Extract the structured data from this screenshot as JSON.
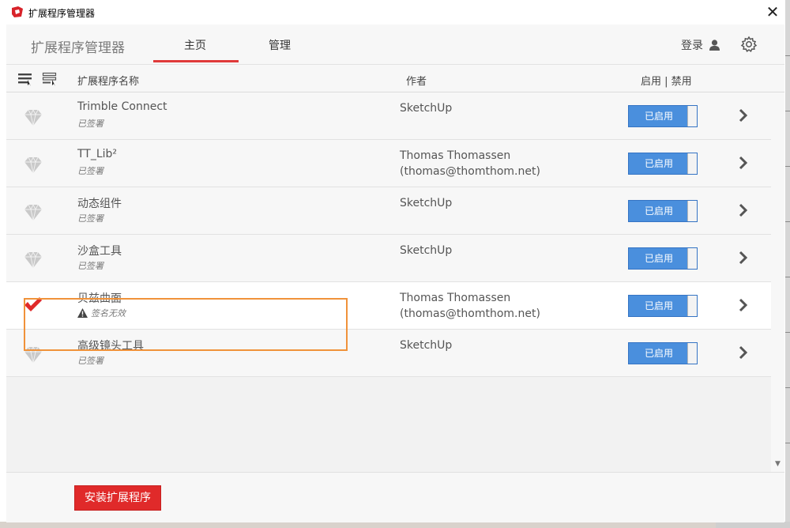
{
  "window": {
    "title": "扩展程序管理器",
    "close_glyph": "✕"
  },
  "header": {
    "title": "扩展程序管理器",
    "tabs": [
      {
        "label": "主页",
        "active": true
      },
      {
        "label": "管理",
        "active": false
      }
    ],
    "login_label": "登录"
  },
  "columns": {
    "name": "扩展程序名称",
    "author": "作者",
    "enable": "启用 | 禁用"
  },
  "extensions": [
    {
      "name": "Trimble Connect",
      "status": "已签署",
      "author": "SketchUp",
      "author_email": "",
      "toggle_label": "已启用",
      "icon": "gem-icon"
    },
    {
      "name": "TT_Lib²",
      "status": "已签署",
      "author": "Thomas Thomassen",
      "author_email": "(thomas@thomthom.net)",
      "toggle_label": "已启用",
      "icon": "gem-icon"
    },
    {
      "name": "动态组件",
      "status": "已签署",
      "author": "SketchUp",
      "author_email": "",
      "toggle_label": "已启用",
      "icon": "gem-icon"
    },
    {
      "name": "沙盒工具",
      "status": "已签署",
      "author": "SketchUp",
      "author_email": "",
      "toggle_label": "已启用",
      "icon": "gem-icon"
    },
    {
      "name": "贝兹曲面",
      "status": "签名无效",
      "author": "Thomas Thomassen",
      "author_email": "(thomas@thomthom.net)",
      "toggle_label": "已启用",
      "icon": "checkmark-icon",
      "selected": true
    },
    {
      "name": "高级镜头工具",
      "status": "已签署",
      "author": "SketchUp",
      "author_email": "",
      "toggle_label": "已启用",
      "icon": "gem-icon"
    }
  ],
  "footer": {
    "install_label": "安装扩展程序"
  },
  "colors": {
    "accent_red": "#e02a2a",
    "toggle_blue": "#4a8fdd",
    "highlight_orange": "#f0923a"
  }
}
